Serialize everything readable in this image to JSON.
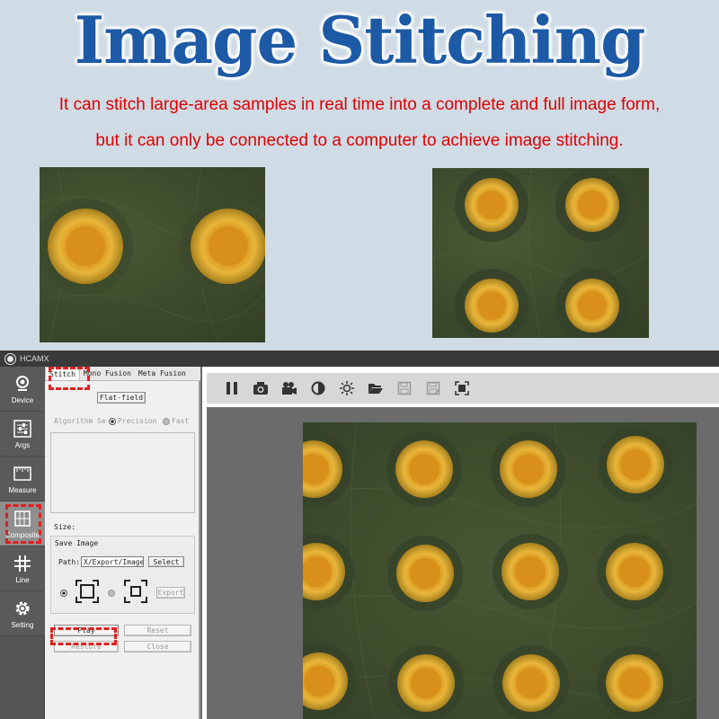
{
  "headline": "Image Stitching",
  "subtext": {
    "line1": "It can stitch large-area samples in real time into a complete and full image form,",
    "line2": "but it can only be connected to a computer to achieve image stitching."
  },
  "colors": {
    "headline": "#1d5aa6",
    "subtext": "#e00000",
    "highlight_dash": "#e02020",
    "pad_gold": "#e0a020"
  },
  "app": {
    "title": "HCAMX",
    "nav": [
      {
        "label": "Device",
        "icon": "webcam-icon"
      },
      {
        "label": "Args",
        "icon": "sliders-icon"
      },
      {
        "label": "Measure",
        "icon": "ruler-icon"
      },
      {
        "label": "Composite",
        "icon": "composite-icon",
        "active": true
      },
      {
        "label": "Line",
        "icon": "grid-icon"
      },
      {
        "label": "Setting",
        "icon": "gear-icon"
      }
    ],
    "tabs": [
      "Stitch",
      "Mono Fusion",
      "Meta Fusion"
    ],
    "panel": {
      "flat_field": "Flat-field",
      "algorithm_label": "Algorithm Se",
      "precision": "Precision",
      "fast": "Fast",
      "size_label": "Size:",
      "save_image_label": "Save Image",
      "path_label": "Path:",
      "path_value": "X/Export/Image",
      "select": "Select",
      "export": "Export",
      "play": "Play",
      "reset": "Reset",
      "restore": "Restore",
      "close": "Close"
    },
    "toolbar": [
      "pause-icon",
      "camera-icon",
      "video-camera-icon",
      "contrast-icon",
      "brightness-icon",
      "open-folder-icon",
      "save-icon",
      "save-as-icon",
      "fit-screen-icon"
    ]
  }
}
